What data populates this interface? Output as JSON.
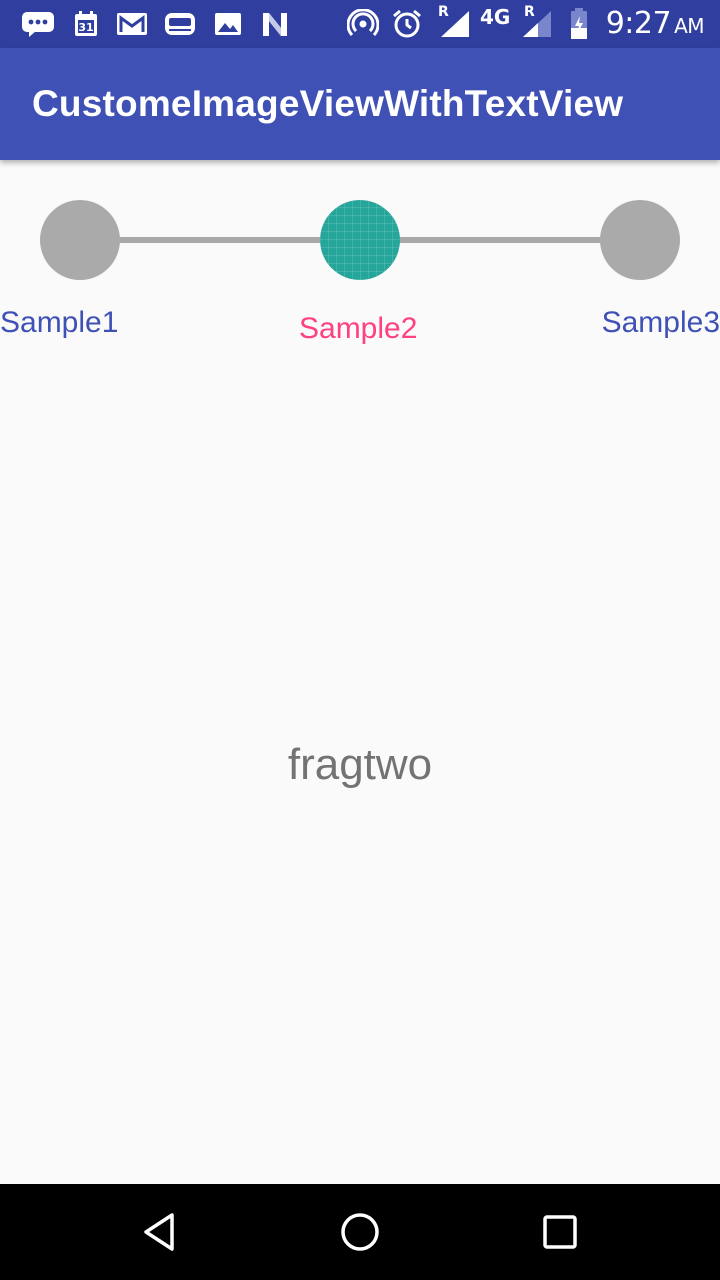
{
  "status_bar": {
    "time": "9:27",
    "ampm": "AM",
    "network": "4G",
    "roaming_1": "R",
    "roaming_2": "R",
    "icons": [
      "message-icon",
      "calendar-icon",
      "gmail-icon",
      "bus-icon",
      "image-icon",
      "n-icon",
      "hotspot-icon",
      "alarm-icon",
      "signal-icon",
      "signal-icon",
      "battery-icon"
    ]
  },
  "app_bar": {
    "title": "CustomeImageViewWithTextView"
  },
  "stepper": {
    "steps": [
      {
        "label": "Sample1",
        "active": false
      },
      {
        "label": "Sample2",
        "active": true
      },
      {
        "label": "Sample3",
        "active": false
      }
    ],
    "colors": {
      "inactive_circle": "#aaaaaa",
      "active_circle": "#26a69a",
      "line": "#a8a8a8",
      "inactive_label": "#3f51b5",
      "active_label": "#ff4081"
    }
  },
  "content": {
    "fragment_text": "fragtwo"
  },
  "nav_bar": {
    "icons": [
      "back-icon",
      "home-icon",
      "recents-icon"
    ]
  }
}
